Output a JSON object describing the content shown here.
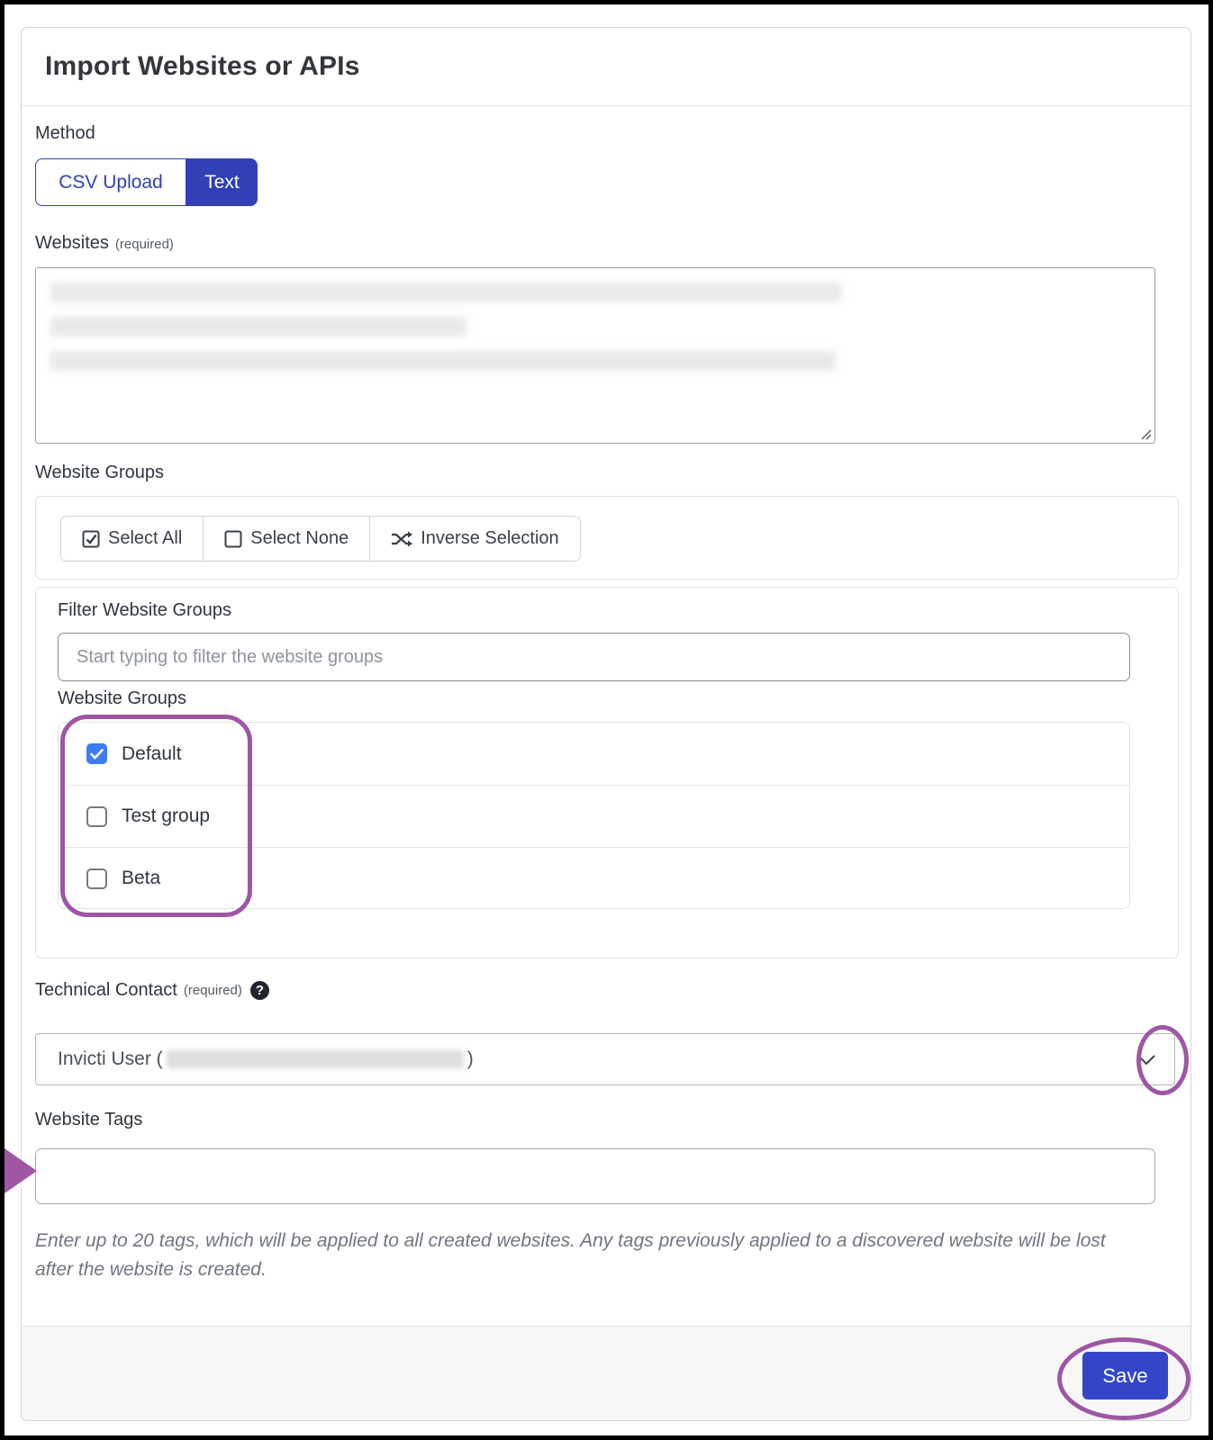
{
  "card": {
    "title": "Import Websites or APIs"
  },
  "method": {
    "label": "Method",
    "csv_option": "CSV Upload",
    "text_option": "Text"
  },
  "websites": {
    "label": "Websites",
    "required_note": "(required)"
  },
  "website_groups": {
    "label": "Website Groups",
    "select_all": "Select All",
    "select_none": "Select None",
    "inverse_selection": "Inverse Selection",
    "filter_label": "Filter Website Groups",
    "filter_placeholder": "Start typing to filter the website groups",
    "list_label": "Website Groups",
    "groups": [
      {
        "name": "Default",
        "checked": true
      },
      {
        "name": "Test group",
        "checked": false
      },
      {
        "name": "Beta",
        "checked": false
      }
    ]
  },
  "technical_contact": {
    "label": "Technical Contact",
    "required_note": "(required)",
    "value_prefix": "Invicti User (",
    "value_suffix": ")"
  },
  "website_tags": {
    "label": "Website Tags",
    "value": "",
    "help_line1": "Enter up to 20 tags, which will be applied to all created websites. Any tags previously applied to a discovered website will be lost",
    "help_line2": "after the website is created."
  },
  "footer": {
    "save_label": "Save"
  },
  "colors": {
    "primary_blue": "#2f41b4",
    "save_blue": "#3346c9",
    "checkbox_blue": "#3e7bf6",
    "annotation_purple": "#9e56a5"
  }
}
